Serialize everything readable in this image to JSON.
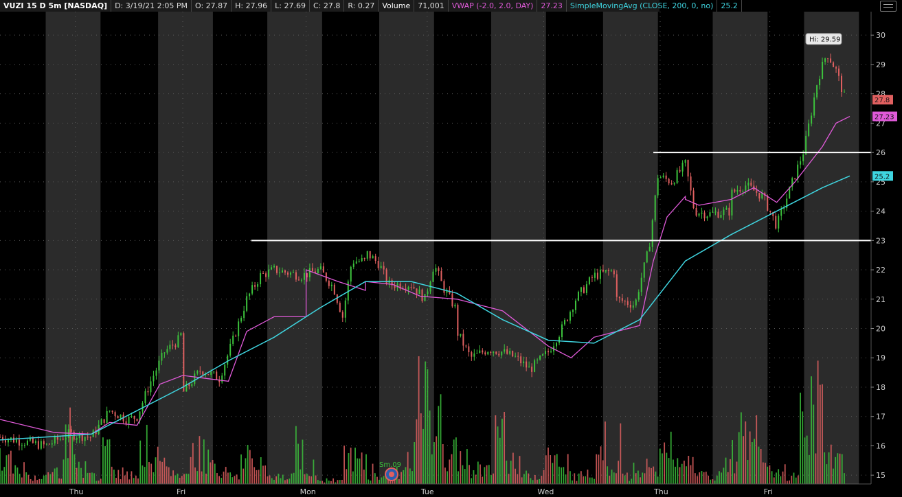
{
  "header": {
    "symbol": "VUZI 15 D 5m [NASDAQ]",
    "date": "D: 3/19/21 2:05 PM",
    "open": "O: 27.87",
    "high": "H: 27.96",
    "low": "L: 27.69",
    "close": "C: 27.8",
    "range": "R: 0.27",
    "volume_label": "Volume",
    "volume_value": "71,001",
    "vwap_label": "VWAP (-2.0, 2.0, DAY)",
    "vwap_value": "27.23",
    "sma_label": "SimpleMovingAvg (CLOSE, 200, 0, no)",
    "sma_value": "25.2"
  },
  "colors": {
    "background": "#000000",
    "session_shade": "#2b2b2b",
    "up": "#3cc23c",
    "down": "#e06060",
    "vwap": "#e05ad9",
    "sma": "#3fd5e0",
    "level_line": "#ffffff",
    "price_tag": "#e06060",
    "vwap_tag": "#e05ad9",
    "sma_tag": "#3fd5e0"
  },
  "chart_data": {
    "type": "candlestick",
    "ylim": [
      14.7,
      30.8
    ],
    "yticks": [
      "15",
      "16",
      "17",
      "18",
      "19",
      "20",
      "21",
      "22",
      "23",
      "24",
      "25",
      "26",
      "27",
      "28",
      "29",
      "30"
    ],
    "x_labels": [
      "Thu",
      "Fri",
      "Mon",
      "Tue",
      "Wed",
      "Thu",
      "Fri"
    ],
    "grid": true,
    "price_path": [
      [
        0.0,
        16.3
      ],
      [
        1.0,
        16.0
      ],
      [
        1.5,
        16.4
      ],
      [
        2.0,
        16.3
      ],
      [
        2.4,
        17.2
      ],
      [
        2.8,
        16.9
      ],
      [
        3.0,
        17.0
      ],
      [
        3.3,
        18.2
      ],
      [
        3.6,
        19.2
      ],
      [
        3.9,
        19.6
      ],
      [
        4.0,
        19.9
      ],
      [
        4.0,
        17.8
      ],
      [
        4.4,
        18.6
      ],
      [
        4.8,
        18.3
      ],
      [
        5.1,
        19.6
      ],
      [
        5.4,
        21.0
      ],
      [
        5.7,
        21.8
      ],
      [
        6.0,
        22.0
      ],
      [
        6.6,
        21.8
      ],
      [
        7.0,
        22.0
      ],
      [
        7.3,
        21.4
      ],
      [
        7.5,
        20.4
      ],
      [
        7.7,
        22.3
      ],
      [
        8.0,
        22.3
      ],
      [
        8.0,
        22.6
      ],
      [
        8.3,
        22.2
      ],
      [
        8.5,
        21.5
      ],
      [
        9.0,
        21.5
      ],
      [
        9.3,
        21.0
      ],
      [
        9.5,
        22.2
      ],
      [
        9.7,
        21.4
      ],
      [
        10.0,
        20.6
      ],
      [
        10.0,
        19.9
      ],
      [
        10.3,
        19.0
      ],
      [
        10.7,
        19.3
      ],
      [
        11.0,
        19.2
      ],
      [
        11.3,
        19.0
      ],
      [
        11.6,
        18.6
      ],
      [
        12.0,
        19.2
      ],
      [
        12.3,
        20.0
      ],
      [
        12.6,
        21.0
      ],
      [
        13.0,
        21.8
      ],
      [
        13.5,
        22.0
      ],
      [
        13.5,
        21.0
      ],
      [
        13.9,
        20.8
      ],
      [
        14.0,
        21.5
      ],
      [
        14.2,
        22.7
      ],
      [
        14.4,
        25.2
      ],
      [
        14.7,
        25.0
      ],
      [
        15.0,
        25.6
      ],
      [
        15.2,
        24.0
      ],
      [
        15.5,
        23.9
      ],
      [
        16.0,
        24.0
      ],
      [
        16.0,
        24.6
      ],
      [
        16.3,
        24.9
      ],
      [
        16.7,
        24.5
      ],
      [
        17.0,
        23.5
      ],
      [
        17.3,
        24.8
      ],
      [
        17.6,
        26.1
      ],
      [
        17.9,
        28.5
      ],
      [
        18.1,
        29.4
      ],
      [
        18.3,
        28.8
      ],
      [
        18.5,
        27.8
      ]
    ],
    "vwap_path": [
      [
        0.0,
        16.9
      ],
      [
        1.2,
        16.45
      ],
      [
        2.0,
        16.4
      ],
      [
        2.4,
        16.8
      ],
      [
        3.0,
        16.7
      ],
      [
        3.5,
        18.1
      ],
      [
        4.0,
        18.4
      ],
      [
        4.0,
        18.4
      ],
      [
        4.5,
        18.3
      ],
      [
        5.0,
        18.2
      ],
      [
        5.4,
        19.9
      ],
      [
        6.0,
        20.4
      ],
      [
        6.7,
        20.4
      ],
      [
        6.7,
        22.0
      ],
      [
        7.4,
        21.6
      ],
      [
        8.0,
        21.3
      ],
      [
        8.0,
        21.6
      ],
      [
        8.6,
        21.5
      ],
      [
        9.2,
        21.1
      ],
      [
        10.0,
        21.0
      ],
      [
        10.0,
        21.0
      ],
      [
        11.0,
        20.6
      ],
      [
        12.0,
        19.4
      ],
      [
        12.5,
        19.0
      ],
      [
        13.0,
        19.7
      ],
      [
        14.0,
        20.1
      ],
      [
        14.3,
        22.3
      ],
      [
        14.6,
        23.8
      ],
      [
        15.0,
        24.5
      ],
      [
        15.0,
        24.4
      ],
      [
        15.3,
        24.2
      ],
      [
        16.0,
        24.4
      ],
      [
        16.5,
        24.8
      ],
      [
        17.0,
        24.3
      ],
      [
        17.4,
        25.0
      ],
      [
        18.0,
        26.2
      ],
      [
        18.3,
        27.0
      ],
      [
        18.6,
        27.23
      ]
    ],
    "sma_path": [
      [
        0.0,
        16.2
      ],
      [
        1.0,
        16.3
      ],
      [
        2.0,
        16.4
      ],
      [
        3.0,
        17.2
      ],
      [
        4.0,
        18.0
      ],
      [
        5.0,
        18.9
      ],
      [
        6.0,
        19.7
      ],
      [
        7.0,
        20.7
      ],
      [
        8.0,
        21.6
      ],
      [
        9.0,
        21.6
      ],
      [
        10.0,
        21.2
      ],
      [
        11.0,
        20.3
      ],
      [
        12.0,
        19.6
      ],
      [
        13.0,
        19.5
      ],
      [
        14.0,
        20.3
      ],
      [
        15.0,
        22.3
      ],
      [
        16.0,
        23.2
      ],
      [
        17.0,
        24.0
      ],
      [
        18.0,
        24.8
      ],
      [
        18.6,
        25.2
      ]
    ],
    "volume_profile": [
      0.3,
      0.15,
      0.1,
      0.1,
      0.15,
      0.6,
      0.2,
      0.1,
      0.35,
      0.15,
      0.1,
      0.45,
      0.2,
      0.15,
      0.1,
      0.4,
      0.35,
      0.15,
      0.1,
      0.35,
      0.2,
      0.1,
      0.1,
      0.35,
      0.1,
      0.05,
      0.05,
      0.3,
      0.3,
      0.1,
      0.1,
      0.15,
      0.4,
      0.95,
      0.7,
      0.35,
      0.3,
      0.2,
      0.15,
      0.7,
      0.3,
      0.1,
      0.1,
      0.35,
      0.15,
      0.1,
      0.15,
      0.5,
      0.25,
      0.1,
      0.1,
      0.15,
      0.6,
      0.2,
      0.25,
      0.1,
      0.1,
      0.35,
      0.55,
      0.4,
      0.2,
      0.15,
      0.1,
      0.8,
      0.95,
      0.45,
      0.3
    ],
    "horizontal_lines": [
      {
        "y": 26.0,
        "x_start": 14.3,
        "x_end": 18.8
      },
      {
        "y": 23.0,
        "x_start": 5.5,
        "x_end": 18.8
      }
    ],
    "annotations": {
      "hi_label": "Hi: 29.59",
      "hi_value": 29.59,
      "last_price_label": "27.8",
      "last_price": 27.8,
      "vwap_tag_label": "27.23",
      "vwap_tag_value": 27.23,
      "sma_tag_label": "25.2",
      "sma_tag_value": 25.2,
      "event_label": "Sm.09"
    }
  }
}
